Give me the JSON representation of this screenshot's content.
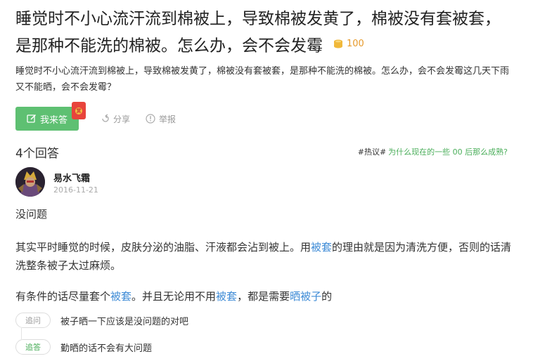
{
  "question": {
    "title": "睡觉时不小心流汗流到棉被上，导致棉被发黄了，棉被没有套被套，是那种不能洗的棉被。怎么办，会不会发霉",
    "reward": "100",
    "description": "睡觉时不小心流汗流到棉被上，导致棉被发黄了，棉被没有套被套，是那种不能洗的棉被。怎么办，会不会发霉这几天下雨又不能晒，会不会发霉？"
  },
  "actions": {
    "answer_label": "我来答",
    "redpack_label": "赏",
    "share_label": "分享",
    "report_label": "举报"
  },
  "answers_count": "4个回答",
  "hot": {
    "tag": "#热议#",
    "link": "为什么现在的一些 00 后那么成熟?"
  },
  "answer": {
    "author": "易水飞霜",
    "date": "2016-11-21",
    "p1": "没问题",
    "p2": {
      "a": "其实平时睡觉的时候，皮肤分泌的油脂、汗液都会沾到被上。用",
      "kw1": "被套",
      "b": "的理由就是因为清洗方便，否则的话清洗整条被子太过麻烦。"
    },
    "p3": {
      "a": "有条件的话尽量套个",
      "kw1": "被套",
      "b": "。并且无论用不用",
      "kw2": "被套",
      "c": "，都是需要",
      "kw3": "晒被子",
      "d": "的"
    }
  },
  "comments": [
    {
      "tag": "追问",
      "text": "被子晒一下应该是没问题的对吧"
    },
    {
      "tag": "追答",
      "text": "勤晒的话不会有大问题"
    }
  ],
  "colors": {
    "accent_green": "#5ec072",
    "link_blue": "#3e8bd6",
    "coin_orange": "#e69a2b",
    "redpack_red": "#e8443c"
  }
}
